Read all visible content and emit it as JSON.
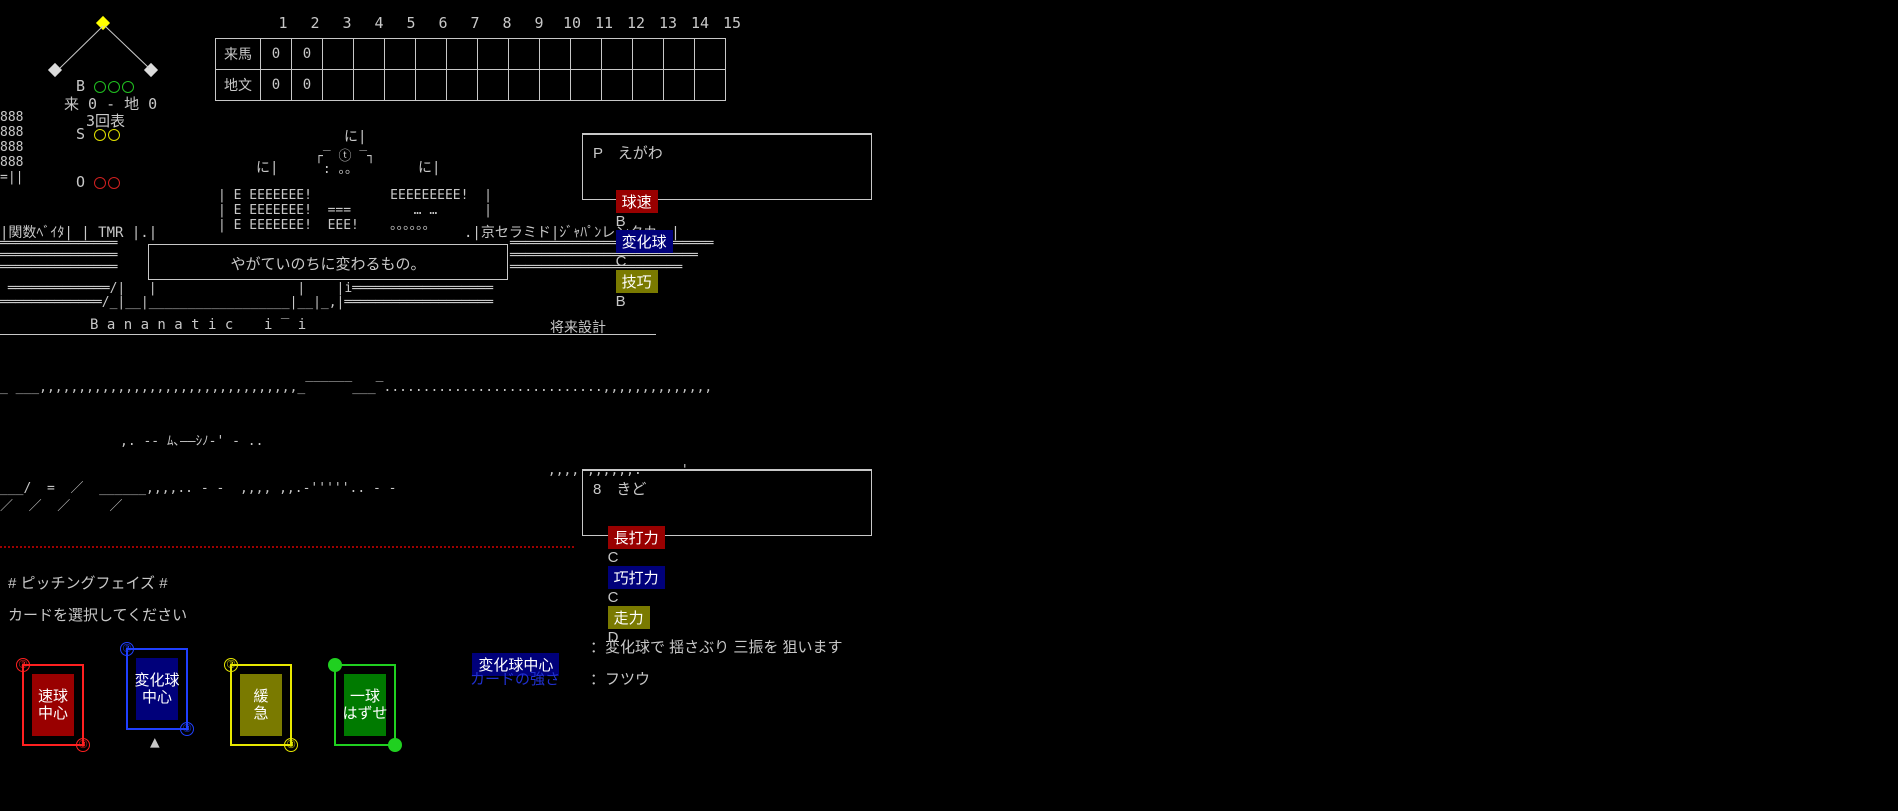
{
  "count": {
    "b_label": "B",
    "s_label": "S",
    "o_label": "O",
    "score_line": "来 0 - 地 0",
    "inning_line": "3回表"
  },
  "scoreboard": {
    "innings": [
      "1",
      "2",
      "3",
      "4",
      "5",
      "6",
      "7",
      "8",
      "9",
      "10",
      "11",
      "12",
      "13",
      "14",
      "15"
    ],
    "rows": [
      {
        "team": "来馬",
        "runs": [
          "0",
          "0",
          "",
          "",
          "",
          "",
          "",
          "",
          "",
          "",
          "",
          "",
          "",
          "",
          ""
        ]
      },
      {
        "team": "地文",
        "runs": [
          "0",
          "0",
          "",
          "",
          "",
          "",
          "",
          "",
          "",
          "",
          "",
          "",
          "",
          "",
          ""
        ]
      }
    ]
  },
  "stadium": {
    "board_text": "やがていのちに変わるもの。",
    "ad_left": "|関数ﾍﾞｲﾀ| | TMR |.|",
    "ad_right": ".|京セラミド|ｼﾞｬﾊﾟﾝレンタカー|",
    "sign_left": "B a n a n a t i c",
    "sign_right": "将来設計",
    "ni_marks": [
      "に|",
      "に|",
      "に|"
    ]
  },
  "pitcher_panel": {
    "name": "P　えがわ",
    "stats": [
      {
        "label": "球速",
        "grade": "B",
        "color": "#990000"
      },
      {
        "label": "変化球",
        "grade": "C",
        "color": "#00007a"
      },
      {
        "label": "技巧",
        "grade": "B",
        "color": "#7a7a00"
      }
    ]
  },
  "batter_panel": {
    "name": "8　きど",
    "stats": [
      {
        "label": "長打力",
        "grade": "C",
        "color": "#990000"
      },
      {
        "label": "巧打力",
        "grade": "C",
        "color": "#00007a"
      },
      {
        "label": "走力",
        "grade": "D",
        "color": "#7a7a00"
      }
    ]
  },
  "phase": {
    "title": "# ピッチングフェイズ #",
    "prompt": "カードを選択してください"
  },
  "cards": [
    {
      "label": "速球\n中心",
      "color": "#990000",
      "border": "#ff2020",
      "badge": "③",
      "selected": false
    },
    {
      "label": "変化球\n中心",
      "color": "#00007a",
      "border": "#2040ff",
      "badge": "③",
      "selected": true
    },
    {
      "label": "緩\n急",
      "color": "#7a7a00",
      "border": "#e8e800",
      "badge": "③",
      "selected": false
    },
    {
      "label": "一球\nはずせ",
      "color": "#007a00",
      "border": "#20d020",
      "badge": "●",
      "selected": false
    }
  ],
  "selected_marker": "▲",
  "card_info": {
    "name_label": "変化球中心",
    "name_desc": "：変化球で 揺さぶり 三振を 狙います",
    "strength_label": "カードの強さ",
    "strength_value": "：フツウ"
  }
}
